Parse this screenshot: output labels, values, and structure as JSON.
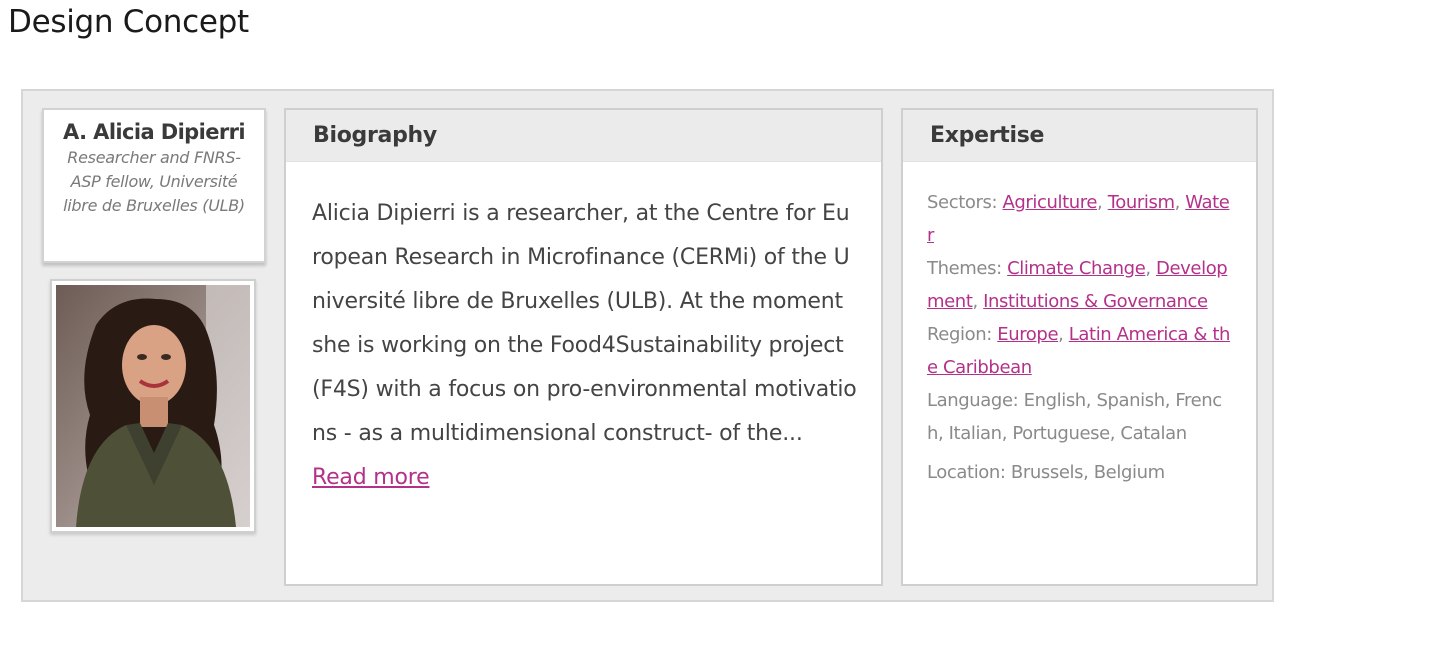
{
  "page": {
    "title": "Design Concept"
  },
  "profile": {
    "name": "A. Alicia Dipierri",
    "role": "Researcher and FNRS-ASP fellow, Université libre de Bruxelles (ULB)",
    "photo_alt": "portrait photo"
  },
  "biography": {
    "heading": "Biography",
    "text": "Alicia Dipierri is a researcher, at the Centre for European Research in Microfinance (CERMi) of the Université libre de Bruxelles (ULB). At the moment she is working on the Food4Sustainability project (F4S) with a focus on pro-environmental motivations - as a multidimensional construct- of the...",
    "read_more": "Read more"
  },
  "expertise": {
    "heading": "Expertise",
    "sectors_label": "Sectors:",
    "sectors": [
      "Agriculture",
      "Tourism",
      "Water"
    ],
    "themes_label": "Themes:",
    "themes": [
      "Climate Change",
      "Development",
      "Institutions & Governance"
    ],
    "region_label": "Region:",
    "regions": [
      "Europe",
      "Latin America & the Caribbean"
    ],
    "language": "Language: English, Spanish, French, Italian, Portuguese, Catalan",
    "location": "Location: Brussels, Belgium"
  },
  "colors": {
    "accent": "#b4318a",
    "panel_bg": "#ececec",
    "header_bg": "#ebebeb"
  },
  "icons": []
}
